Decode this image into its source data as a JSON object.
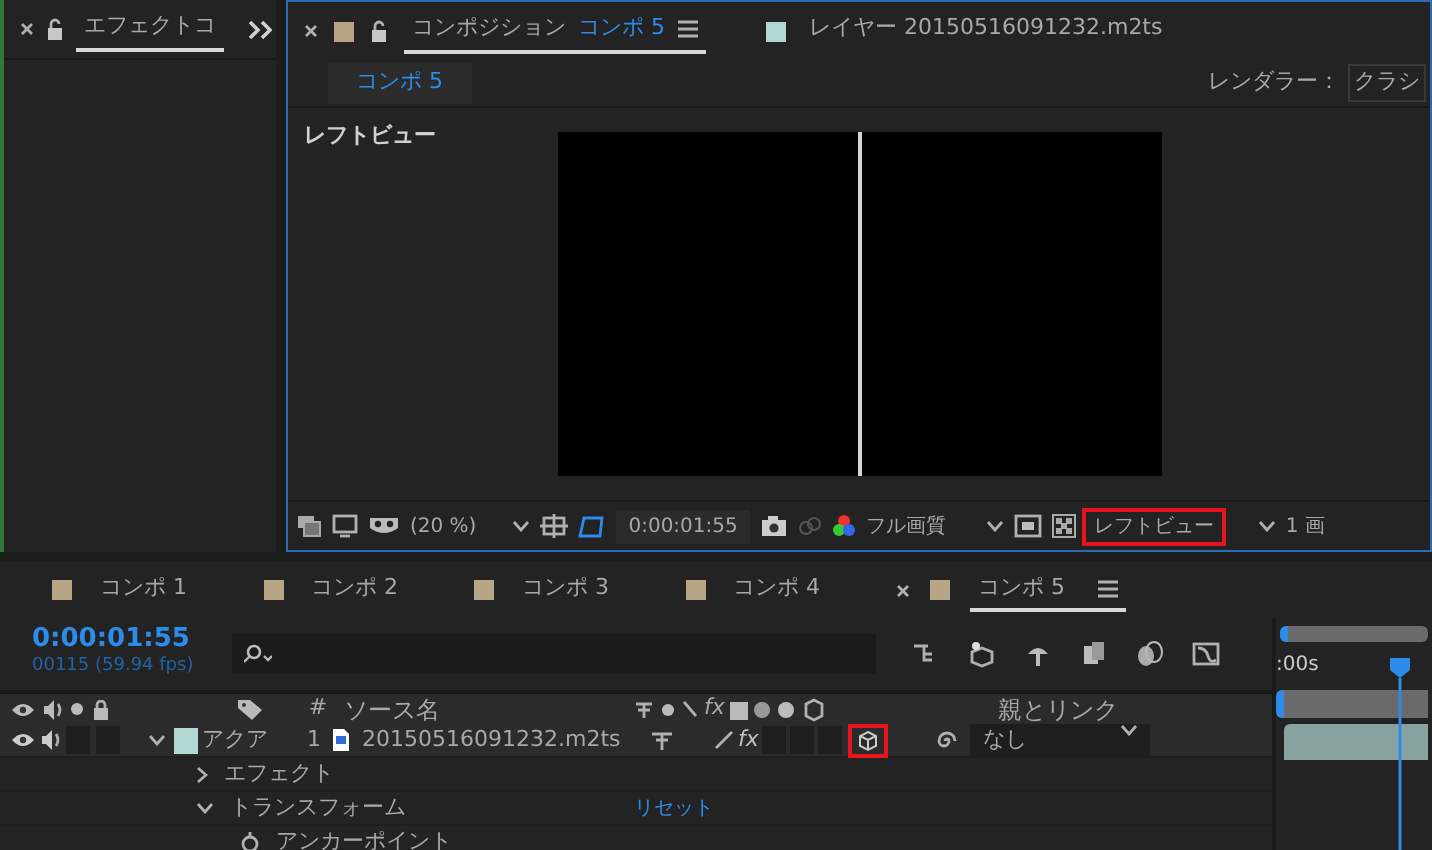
{
  "effects_panel": {
    "tab_label": "エフェクトコ",
    "selected": true
  },
  "composition_panel": {
    "tabs": [
      {
        "kind": "comp",
        "label": "コンポジション",
        "comp_name": "コンポ 5",
        "selected": true,
        "color": "#b5a584"
      },
      {
        "kind": "layer",
        "label": "レイヤー 20150516091232.m2ts",
        "selected": false,
        "color": "#b3d8d4"
      }
    ],
    "breadcrumb": "コンポ 5",
    "renderer_label": "レンダラー：",
    "renderer_value": "クラシ",
    "view_label": "レフトビュー",
    "toolbar": {
      "zoom": "(20 %)",
      "timecode": "0:00:01:55",
      "resolution": "フル画質",
      "view": "レフトビュー",
      "view_highlighted": true,
      "views_count": "1 画"
    }
  },
  "timeline": {
    "tabs": [
      {
        "label": "コンポ 1",
        "selected": false,
        "color": "#b5a584"
      },
      {
        "label": "コンポ 2",
        "selected": false,
        "color": "#b5a584"
      },
      {
        "label": "コンポ 3",
        "selected": false,
        "color": "#b5a584"
      },
      {
        "label": "コンポ 4",
        "selected": false,
        "color": "#b5a584"
      },
      {
        "label": "コンポ 5",
        "selected": true,
        "color": "#b5a584"
      }
    ],
    "timecode": "0:00:01:55",
    "frame_info": "00115 (59.94 fps)",
    "ruler_label": ":00s",
    "columns": {
      "number": "#",
      "source": "ソース名",
      "effects": "fx",
      "parent": "親とリンク"
    },
    "layers": [
      {
        "color": "#b3d8d4",
        "label_name": "アクア",
        "number": "1",
        "source": "20150516091232.m2ts",
        "effects_switch": "fx",
        "effects_on": true,
        "parent": "なし",
        "expanded": true,
        "three_d_highlighted": true,
        "children": [
          {
            "name": "エフェクト",
            "expanded": false
          },
          {
            "name": "トランスフォーム",
            "expanded": true,
            "action": "リセット",
            "children": [
              {
                "name": "アンカーポイント"
              }
            ]
          }
        ]
      }
    ]
  }
}
